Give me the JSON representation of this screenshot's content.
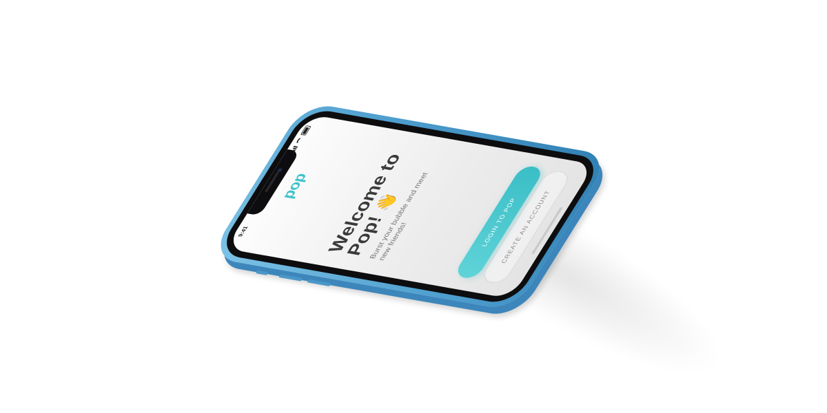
{
  "status_bar": {
    "time": "9:41"
  },
  "app": {
    "logo_text": "pop",
    "brand_color": "#3cc2c9"
  },
  "welcome": {
    "title_line1": "Welcome to",
    "title_line2": "Pop!",
    "wave_icon": "waving-hand-icon",
    "subtitle": "Burst your bubble and meet new friends!"
  },
  "actions": {
    "login_label": "LOGIN TO POP",
    "create_label": "CREATE AN ACCOUNT"
  },
  "device": {
    "frame_color": "#5aa8d6"
  }
}
